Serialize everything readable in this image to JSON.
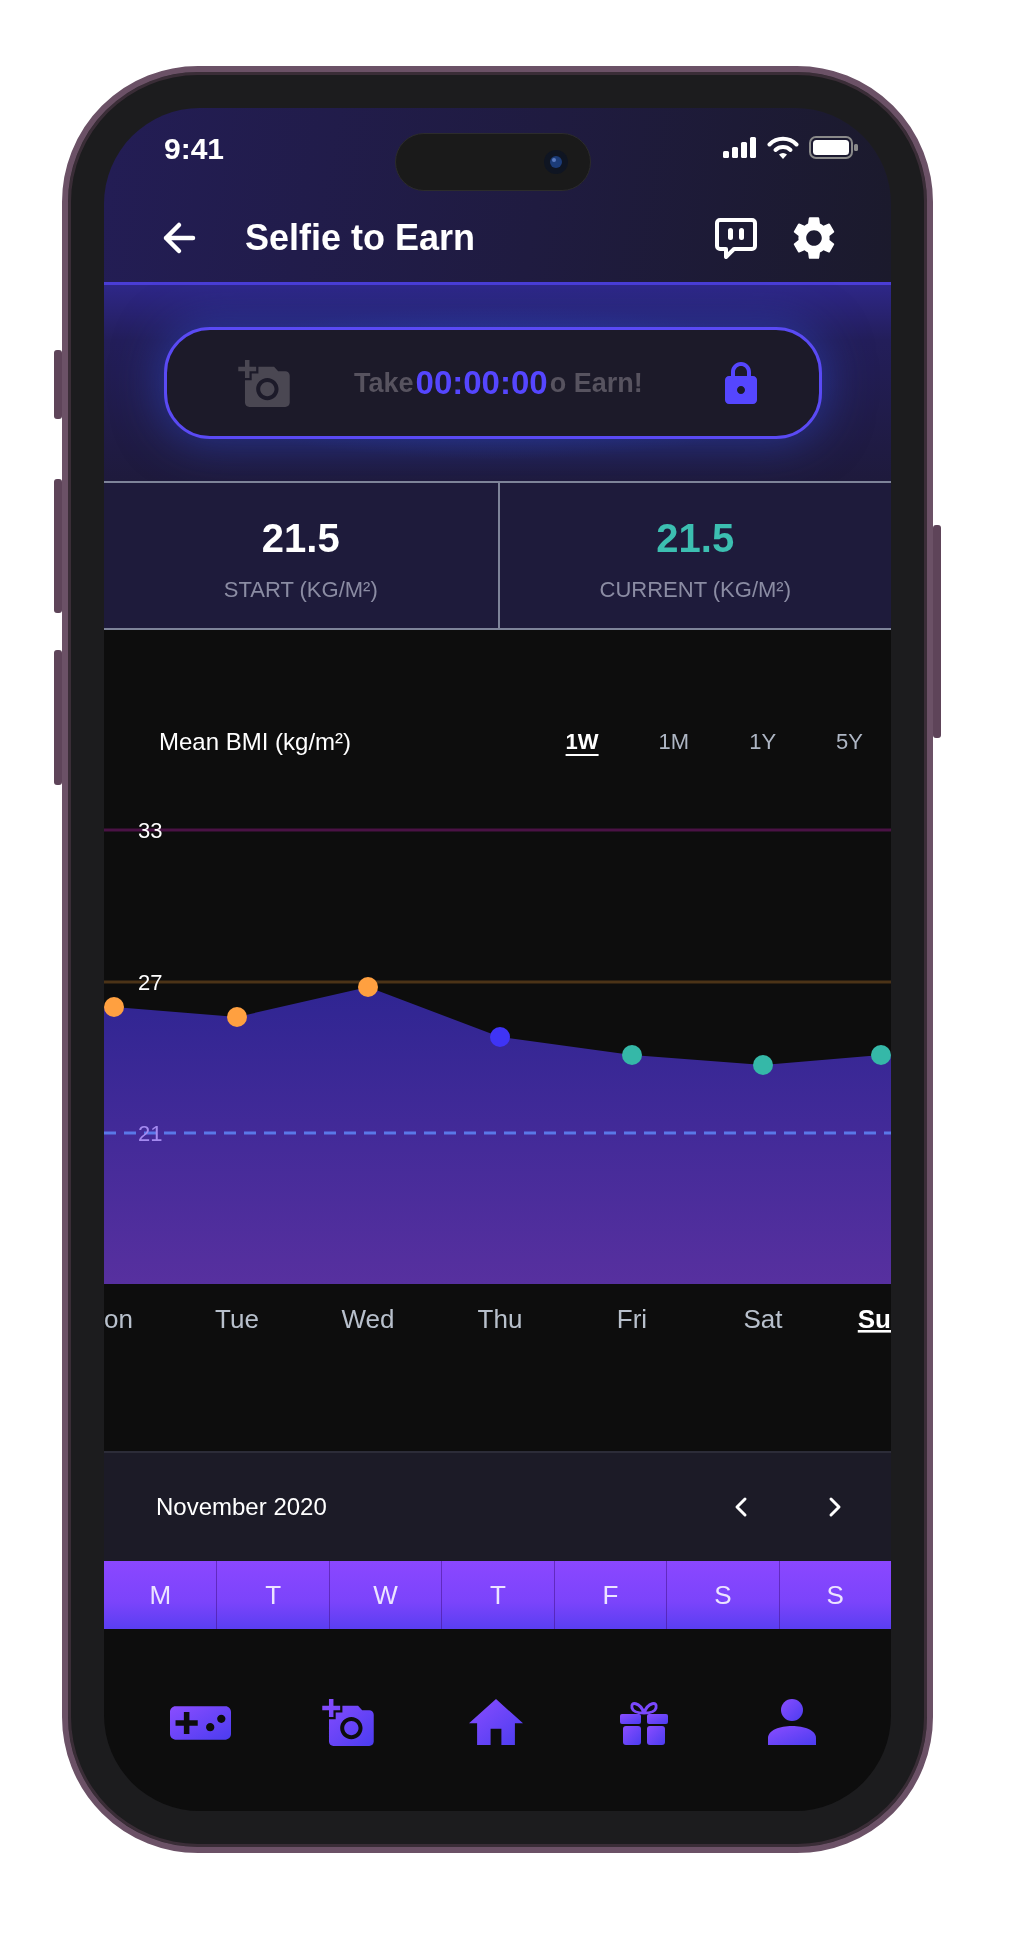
{
  "status_bar": {
    "time": "9:41"
  },
  "header": {
    "title": "Selfie to Earn"
  },
  "selfie_button": {
    "disabled": true,
    "label_parts": [
      "Take",
      "o Earn!"
    ],
    "timer": "00:00:00",
    "locked": true
  },
  "stats": [
    {
      "value": "21.5",
      "label": "START (KG/M²)",
      "color": "#ffffff"
    },
    {
      "value": "21.5",
      "label": "CURRENT (KG/M²)",
      "color": "#3cbfb1"
    }
  ],
  "chart": {
    "title": "Mean BMI (kg/m²)",
    "ranges": [
      {
        "label": "1W",
        "selected": true
      },
      {
        "label": "1M",
        "selected": false
      },
      {
        "label": "1Y",
        "selected": false
      },
      {
        "label": "5Y",
        "selected": false
      }
    ],
    "reference_lines": [
      {
        "label": "33",
        "color": "#4a1245",
        "kind": "solid"
      },
      {
        "label": "27",
        "color": "#4b3317",
        "kind": "solid"
      },
      {
        "label": "21",
        "color": "#5a78e8",
        "kind": "dashed"
      }
    ],
    "days": [
      {
        "label": "on",
        "selected": false,
        "color": "#ffa040"
      },
      {
        "label": "Tue",
        "selected": false,
        "color": "#ffa040"
      },
      {
        "label": "Wed",
        "selected": false,
        "color": "#ffa040"
      },
      {
        "label": "Thu",
        "selected": false,
        "color": "#3f34f5"
      },
      {
        "label": "Fri",
        "selected": false,
        "color": "#35b8a8"
      },
      {
        "label": "Sat",
        "selected": false,
        "color": "#35b8a8"
      },
      {
        "label": "Su",
        "selected": true,
        "color": "#35b8a8"
      }
    ]
  },
  "calendar": {
    "month": "November 2020",
    "weekdays": [
      "M",
      "T",
      "W",
      "T",
      "F",
      "S",
      "S"
    ]
  }
}
